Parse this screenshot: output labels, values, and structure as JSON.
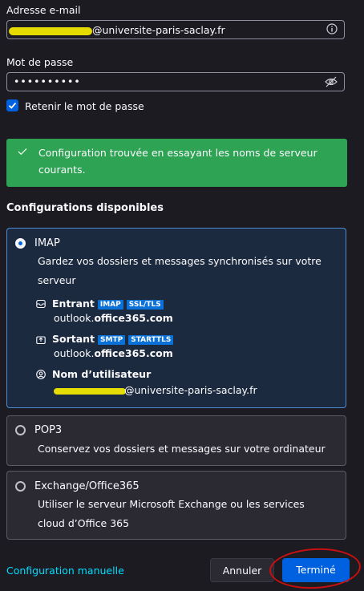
{
  "email": {
    "label": "Adresse e-mail",
    "value": "@universite-paris-saclay.fr"
  },
  "password": {
    "label": "Mot de passe",
    "value": "••••••••••"
  },
  "remember": {
    "label": "Retenir le mot de passe",
    "checked": true
  },
  "banner": {
    "text": "Configuration trouvée en essayant les noms de serveur courants.",
    "color": "#2ea353"
  },
  "configs": {
    "heading": "Configurations disponibles",
    "imap": {
      "title": "IMAP",
      "desc": "Gardez vos dossiers et messages synchronisés sur votre serveur",
      "incoming": {
        "label": "Entrant",
        "tags": [
          "IMAP",
          "SSL/TLS"
        ],
        "host_prefix": "outlook.",
        "host_bold": "office365.com"
      },
      "outgoing": {
        "label": "Sortant",
        "tags": [
          "SMTP",
          "STARTTLS"
        ],
        "host_prefix": "outlook.",
        "host_bold": "office365.com"
      },
      "username": {
        "label": "Nom d’utilisateur",
        "value": "@universite-paris-saclay.fr"
      }
    },
    "pop3": {
      "title": "POP3",
      "desc": "Conservez vos dossiers et messages sur votre ordinateur"
    },
    "exchange": {
      "title": "Exchange/Office365",
      "desc": "Utiliser le serveur Microsoft Exchange ou les services cloud d’Office 365"
    }
  },
  "footer": {
    "manual_link": "Configuration manuelle",
    "cancel": "Annuler",
    "done": "Terminé"
  },
  "colors": {
    "accent": "#0061e0",
    "link": "#00ddff",
    "annotation": "#c90f0f",
    "highlight": "#f0e600"
  }
}
